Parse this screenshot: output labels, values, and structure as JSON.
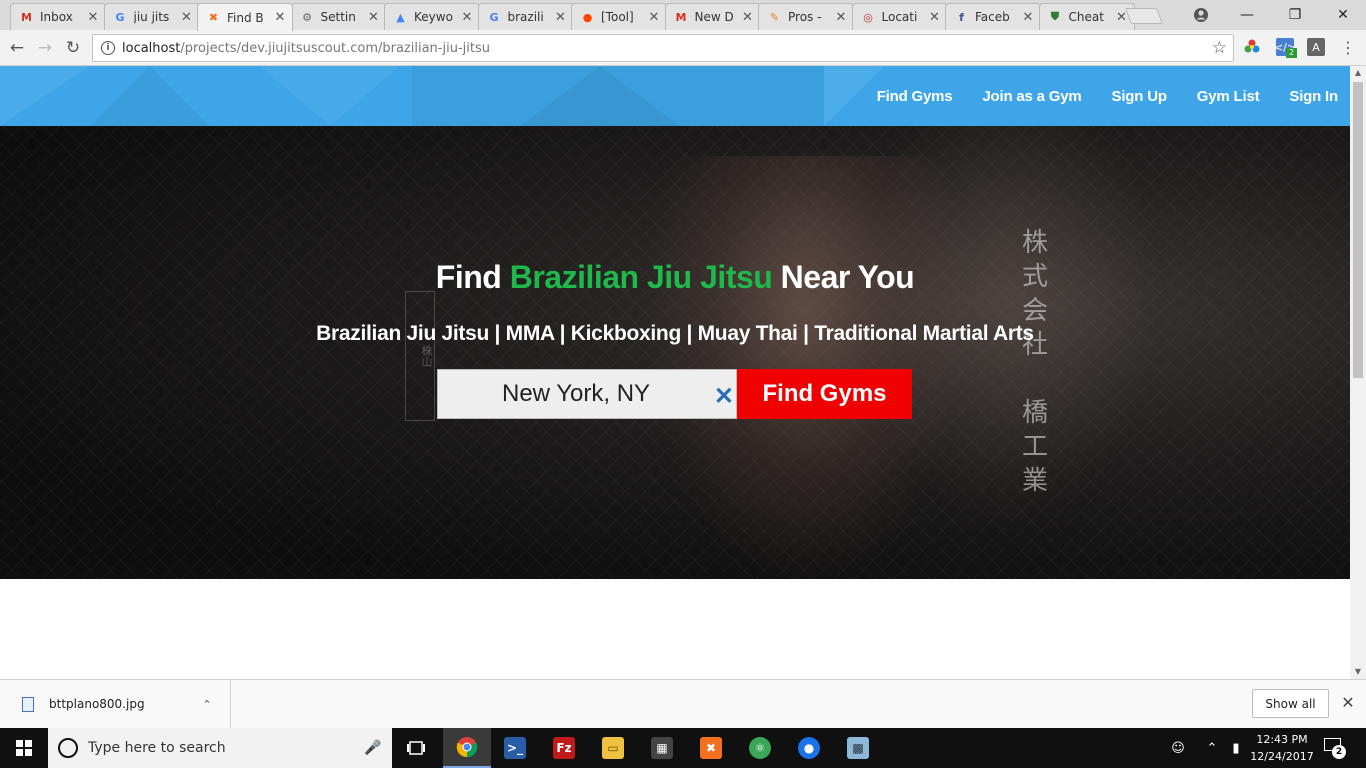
{
  "browser": {
    "tabs": [
      {
        "label": "Inbox",
        "icon": "gmail-icon",
        "color": "#d93025"
      },
      {
        "label": "jiu jits",
        "icon": "google-icon",
        "color": "#4285f4"
      },
      {
        "label": "Find B",
        "icon": "xampp-icon",
        "color": "#f37021"
      },
      {
        "label": "Settin",
        "icon": "gear-icon",
        "color": "#666666"
      },
      {
        "label": "Keywo",
        "icon": "google-ads-icon",
        "color": "#4285f4"
      },
      {
        "label": "brazili",
        "icon": "google-icon",
        "color": "#4285f4"
      },
      {
        "label": "[Tool]",
        "icon": "reddit-icon",
        "color": "#ff4500"
      },
      {
        "label": "New D",
        "icon": "gmail-icon",
        "color": "#d93025"
      },
      {
        "label": "Pros -",
        "icon": "pin-icon",
        "color": "#e67e22"
      },
      {
        "label": "Locati",
        "icon": "location-icon",
        "color": "#c0392b"
      },
      {
        "label": "Faceb",
        "icon": "facebook-icon",
        "color": "#3b5998"
      },
      {
        "label": "Cheat",
        "icon": "shield-icon",
        "color": "#2e7d32"
      }
    ],
    "url_host": "localhost",
    "url_path": "/projects/dev.jiujitsuscout.com/brazilian-jiu-jitsu",
    "ext_badge": "2",
    "ext_letter": "A"
  },
  "site": {
    "nav": [
      "Find Gyms",
      "Join as a Gym",
      "Sign Up",
      "Gym List",
      "Sign In"
    ],
    "hero_title_pre": "Find ",
    "hero_title_highlight": "Brazilian Jiu Jitsu",
    "hero_title_post": " Near You",
    "hero_subtitle": "Brazilian Jiu Jitsu | MMA | Kickboxing | Muay Thai | Traditional Martial Arts",
    "search_value": "New York, NY",
    "search_clear": "✕",
    "search_button": "Find Gyms",
    "accent_green": "#1fb84a",
    "nav_blue": "#3ea6e8",
    "button_red": "#f00000"
  },
  "downloads": {
    "file_name": "bttplano800.jpg",
    "show_all": "Show all"
  },
  "taskbar": {
    "search_placeholder": "Type here to search",
    "time": "12:43 PM",
    "date": "12/24/2017",
    "notification_count": "2"
  }
}
